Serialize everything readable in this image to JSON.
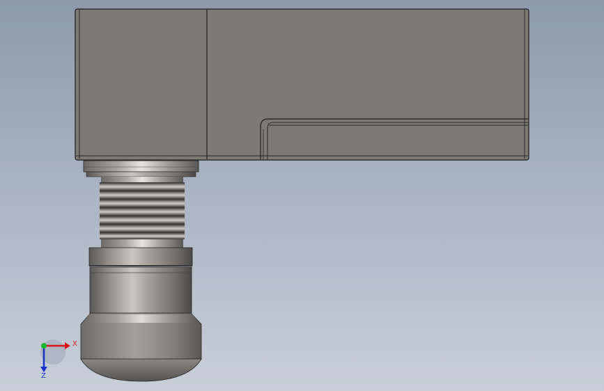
{
  "viewport": {
    "background_top": "#8d9aac",
    "background_bottom": "#c8cfd9"
  },
  "part": {
    "body_color": "#7d7a76",
    "edge_color": "#1c1c1c",
    "metal_dark": "#4a4847",
    "metal_light": "#e6e4e2"
  },
  "triad": {
    "x_label": "X",
    "z_label": "Z",
    "x_color": "#d8161a",
    "y_color": "#17b82e",
    "z_color": "#1630c8",
    "icon": "coordinate-triad-icon"
  }
}
